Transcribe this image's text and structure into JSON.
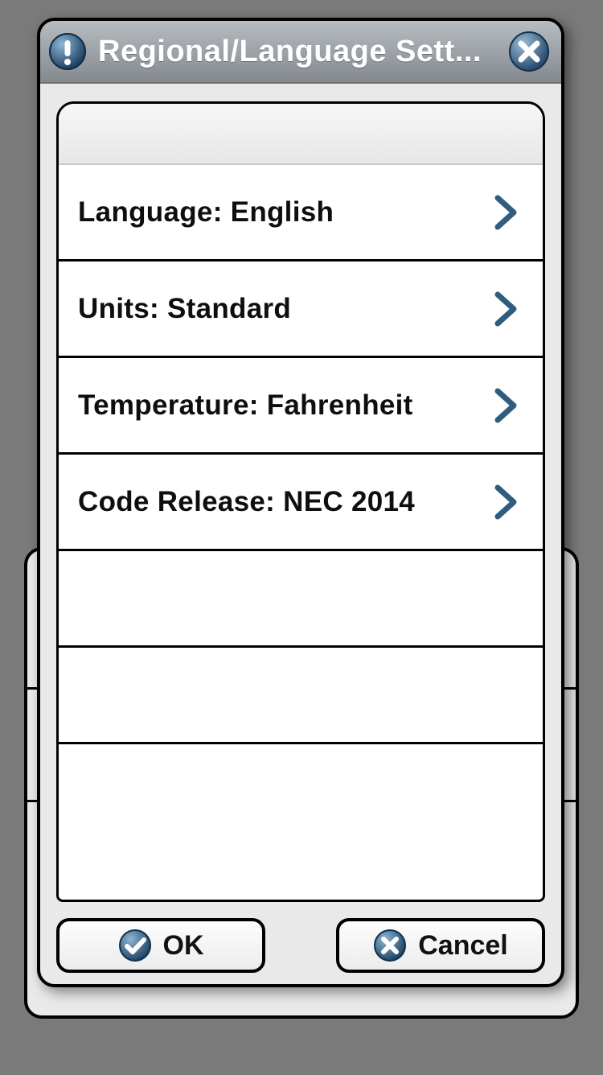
{
  "dialog": {
    "title": "Regional/Language Sett...",
    "rows": [
      {
        "label": "Language: English",
        "has_chevron": true
      },
      {
        "label": "Units: Standard",
        "has_chevron": true
      },
      {
        "label": "Temperature: Fahrenheit",
        "has_chevron": true
      },
      {
        "label": "Code Release: NEC 2014",
        "has_chevron": true
      },
      {
        "label": "",
        "has_chevron": false
      },
      {
        "label": "",
        "has_chevron": false
      },
      {
        "label": "",
        "has_chevron": false
      }
    ],
    "buttons": {
      "ok": "OK",
      "cancel": "Cancel"
    }
  }
}
